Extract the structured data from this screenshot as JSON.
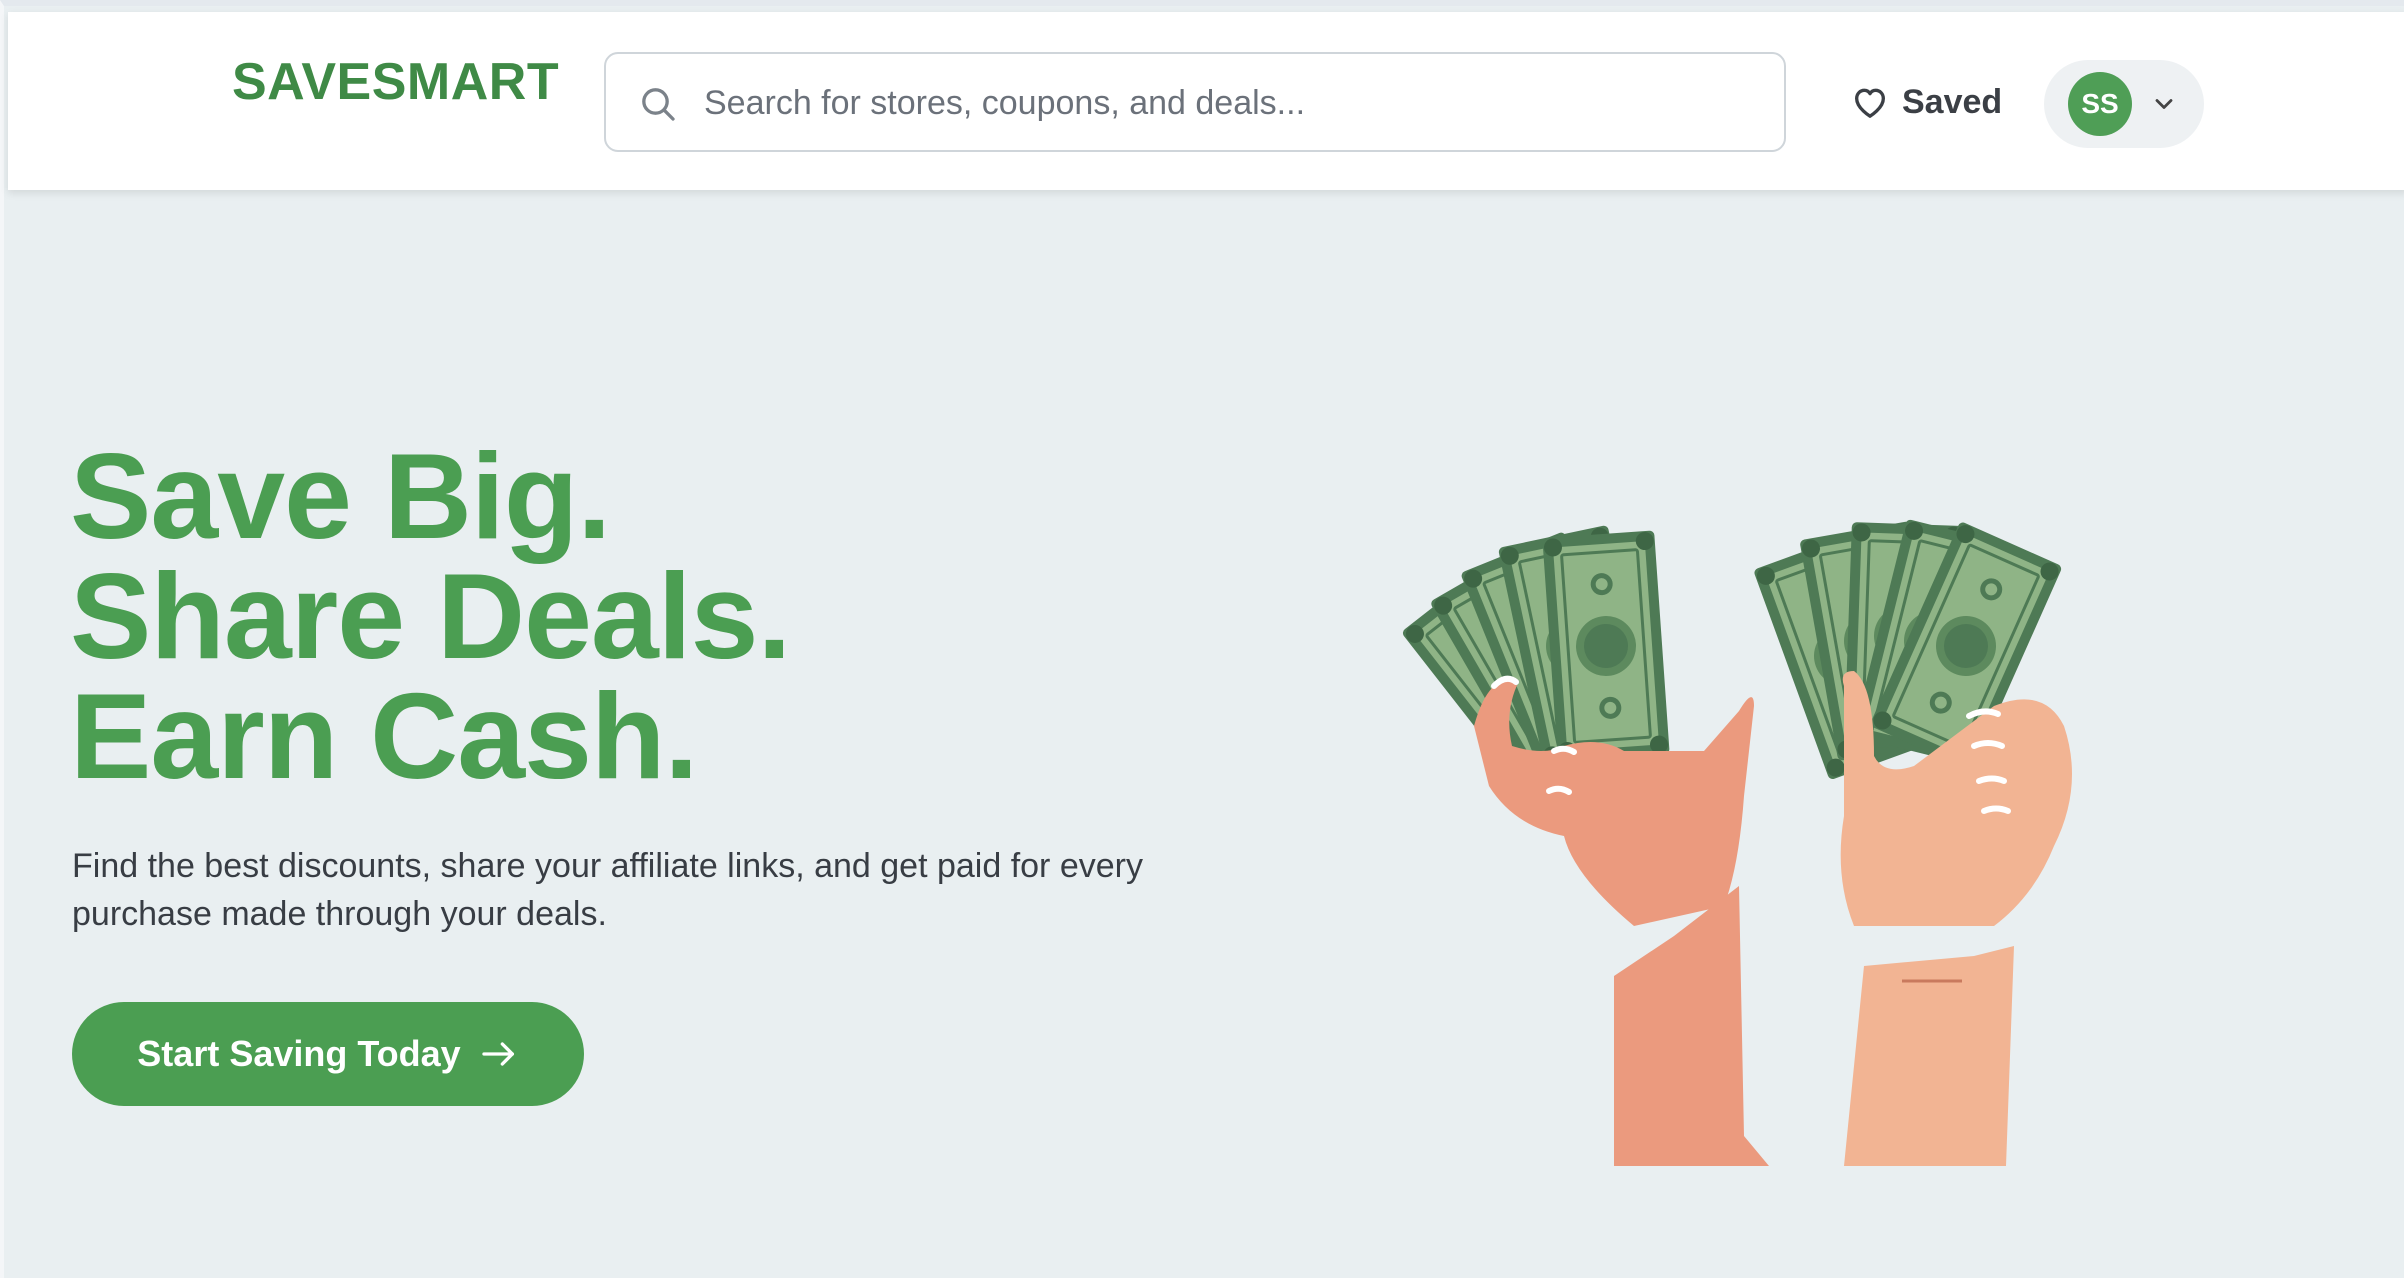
{
  "header": {
    "brand": "SAVESMART",
    "search": {
      "placeholder": "Search for stores, coupons, and deals...",
      "value": "",
      "icon": "search-icon"
    },
    "saved_label": "Saved",
    "user": {
      "initials": "SS",
      "menu_icon": "chevron-down-icon"
    }
  },
  "hero": {
    "title_lines": [
      "Save Big.",
      "Share Deals.",
      "Earn Cash."
    ],
    "subtitle": "Find the best discounts, share your affiliate links, and get paid for every purchase made through your deals.",
    "cta_label": "Start Saving Today",
    "cta_icon": "arrow-right-icon",
    "illustration": "hands-holding-cash-illustration"
  },
  "colors": {
    "brand_green": "#4b9e52",
    "brand_dark_green": "#3f8a46",
    "hero_background": "#e9eff1",
    "header_background": "#ffffff",
    "cash_green": "#4e7a55",
    "skin": "#eb9a7e"
  }
}
